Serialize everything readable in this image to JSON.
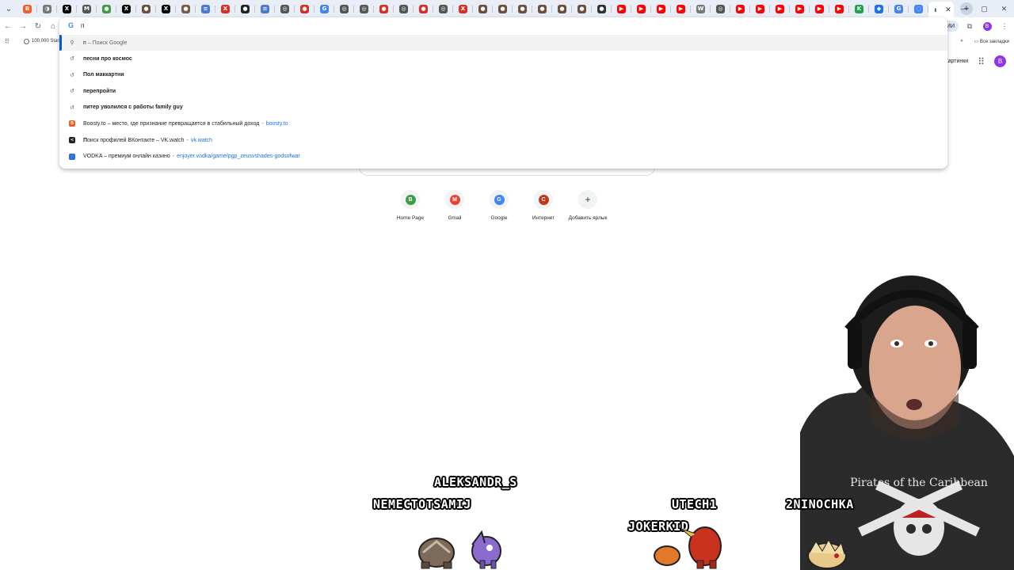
{
  "browser": {
    "tab_icons": [
      {
        "name": "boosty-tab-icon",
        "glyph": "B",
        "color": "#f15f2c"
      },
      {
        "name": "sketch-tab-icon",
        "glyph": "◑",
        "color": "#777777"
      },
      {
        "name": "x-tab-icon",
        "glyph": "X",
        "color": "#000000"
      },
      {
        "name": "mail-tab-icon",
        "glyph": "M",
        "color": "#555555"
      },
      {
        "name": "green-tab-icon",
        "glyph": "●",
        "color": "#3f9b46"
      },
      {
        "name": "x-tab-icon",
        "glyph": "X",
        "color": "#000000"
      },
      {
        "name": "avatar-tab-icon",
        "glyph": "●",
        "color": "#6b4f3f"
      },
      {
        "name": "x-tab-icon",
        "glyph": "X",
        "color": "#000000"
      },
      {
        "name": "avatar-tab-icon",
        "glyph": "●",
        "color": "#7a5b45"
      },
      {
        "name": "doc-tab-icon",
        "glyph": "≡",
        "color": "#4a78d4"
      },
      {
        "name": "red-x-tab-icon",
        "glyph": "X",
        "color": "#d93025"
      },
      {
        "name": "dark-tab-icon",
        "glyph": "●",
        "color": "#222222"
      },
      {
        "name": "doc-tab-icon",
        "glyph": "≡",
        "color": "#4a78d4"
      },
      {
        "name": "globe-tab-icon",
        "glyph": "◎",
        "color": "#555555"
      },
      {
        "name": "red-tab-icon",
        "glyph": "●",
        "color": "#d93025"
      },
      {
        "name": "google-tab-icon",
        "glyph": "G",
        "color": "#4285f4"
      },
      {
        "name": "globe-tab-icon",
        "glyph": "◎",
        "color": "#555555"
      },
      {
        "name": "globe-tab-icon",
        "glyph": "◎",
        "color": "#555555"
      },
      {
        "name": "red-tab-icon",
        "glyph": "●",
        "color": "#d93025"
      },
      {
        "name": "globe-tab-icon",
        "glyph": "◎",
        "color": "#555555"
      },
      {
        "name": "red-tab-icon",
        "glyph": "●",
        "color": "#d93025"
      },
      {
        "name": "globe-tab-icon",
        "glyph": "◎",
        "color": "#555555"
      },
      {
        "name": "red-x-tab-icon",
        "glyph": "X",
        "color": "#d93025"
      },
      {
        "name": "avatar-tab-icon",
        "glyph": "●",
        "color": "#6b4f3f"
      },
      {
        "name": "avatar-tab-icon",
        "glyph": "●",
        "color": "#6b4f3f"
      },
      {
        "name": "avatar-tab-icon",
        "glyph": "●",
        "color": "#6b4f3f"
      },
      {
        "name": "avatar-tab-icon",
        "glyph": "●",
        "color": "#6b4f3f"
      },
      {
        "name": "avatar-tab-icon",
        "glyph": "●",
        "color": "#6b4f3f"
      },
      {
        "name": "avatar-tab-icon",
        "glyph": "●",
        "color": "#6b4f3f"
      },
      {
        "name": "incognito-tab-icon",
        "glyph": "●",
        "color": "#333333"
      },
      {
        "name": "youtube-tab-icon",
        "glyph": "▶",
        "color": "#ff0000"
      },
      {
        "name": "youtube-tab-icon",
        "glyph": "▶",
        "color": "#ff0000"
      },
      {
        "name": "youtube-tab-icon",
        "glyph": "▶",
        "color": "#ff0000"
      },
      {
        "name": "youtube-tab-icon",
        "glyph": "▶",
        "color": "#ff0000"
      },
      {
        "name": "wikipedia-tab-icon",
        "glyph": "W",
        "color": "#777777"
      },
      {
        "name": "globe-tab-icon",
        "glyph": "◎",
        "color": "#555555"
      },
      {
        "name": "youtube-tab-icon",
        "glyph": "▶",
        "color": "#ff0000"
      },
      {
        "name": "youtube-tab-icon",
        "glyph": "▶",
        "color": "#ff0000"
      },
      {
        "name": "youtube-tab-icon",
        "glyph": "▶",
        "color": "#ff0000"
      },
      {
        "name": "youtube-tab-icon",
        "glyph": "▶",
        "color": "#ff0000"
      },
      {
        "name": "youtube-tab-icon",
        "glyph": "▶",
        "color": "#ff0000"
      },
      {
        "name": "youtube-tab-icon",
        "glyph": "▶",
        "color": "#ff0000"
      },
      {
        "name": "green-k-tab-icon",
        "glyph": "K",
        "color": "#1ea446"
      },
      {
        "name": "blue-tab-icon",
        "glyph": "◆",
        "color": "#1a73e8"
      },
      {
        "name": "google-tab-icon",
        "glyph": "G",
        "color": "#4285f4"
      },
      {
        "name": "loading-tab-icon",
        "glyph": "◌",
        "color": "#4285f4"
      }
    ],
    "omnibox_text": "п",
    "ai_mode_label": "Режим ИИ",
    "bookmark_item": "100,000 Stars",
    "all_bookmarks": "Все закладки",
    "images_link": "Картинки",
    "profile_initial": "B"
  },
  "omnibox": {
    "input_prefix": "п",
    "input_hint": " – Поиск Google",
    "suggestions": [
      {
        "type": "history",
        "bold": "п",
        "rest": "есни про космос",
        "url": ""
      },
      {
        "type": "history",
        "bold": "П",
        "rest": "ол маккартни",
        "url": ""
      },
      {
        "type": "history",
        "bold": "п",
        "rest": "ерепройти",
        "url": ""
      },
      {
        "type": "history",
        "bold": "п",
        "rest": "итер уволился с работы family guy",
        "url": ""
      },
      {
        "type": "site",
        "bold": "",
        "rest": "Boosty.to – место, где признание превращается в стабильный доход",
        "url": "boosty.to",
        "icon": "boosty",
        "color": "#f15f2c",
        "glyph": "B"
      },
      {
        "type": "site",
        "bold": "П",
        "rest": "оиск профилей ВКонтакте – VK.watch",
        "url": "vk.watch",
        "icon": "vk",
        "color": "#222222",
        "glyph": "≺"
      },
      {
        "type": "site",
        "bold": "",
        "rest": "VODKA – премиум онлайн казино",
        "url": "enjoyer.vodka/game/pgp_zeusvshades-godsofwar",
        "icon": "vodka",
        "color": "#2a6fdb",
        "glyph": "◌"
      }
    ]
  },
  "shortcuts": [
    {
      "label": "Home Page",
      "glyph": "B",
      "color": "#3f9b46"
    },
    {
      "label": "Gmail",
      "glyph": "M",
      "color": "#ea4335"
    },
    {
      "label": "Google",
      "glyph": "G",
      "color": "#4285f4"
    },
    {
      "label": "Интернет",
      "glyph": "C",
      "color": "#c0391b"
    },
    {
      "label": "Добавить ярлык",
      "glyph": "+",
      "color": "#f1f3f4"
    }
  ],
  "overlay": {
    "chatters": [
      "ALEKSANDR_S",
      "NEMECTOTSAMIJ",
      "UTECH1",
      "2NINOCHKA",
      "JOKERKID"
    ]
  }
}
